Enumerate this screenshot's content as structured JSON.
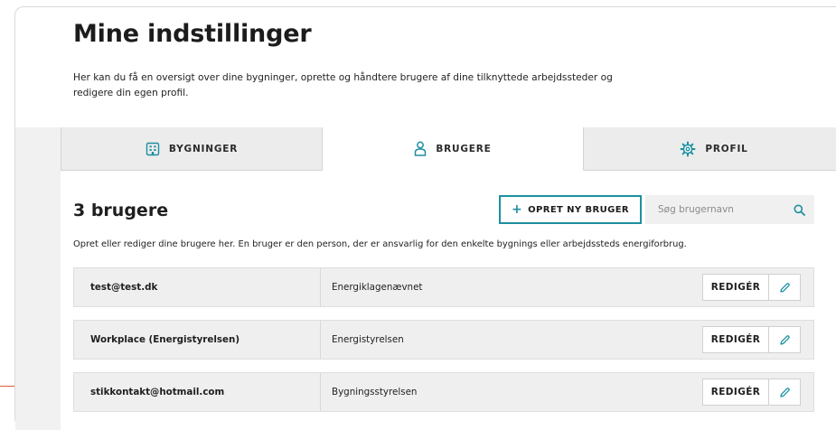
{
  "page": {
    "title": "Mine indstillinger",
    "intro": "Her kan du få en oversigt over dine bygninger, oprette og håndtere brugere af dine tilknyttede arbejdssteder og redigere din egen profil."
  },
  "tabs": [
    {
      "label": "BYGNINGER",
      "icon": "building-icon",
      "active": false
    },
    {
      "label": "BRUGERE",
      "icon": "user-icon",
      "active": true
    },
    {
      "label": "PROFIL",
      "icon": "gear-icon",
      "active": false
    }
  ],
  "users_section": {
    "heading": "3 brugere",
    "create_label": "OPRET NY BRUGER",
    "create_icon": "plus-icon",
    "search_placeholder": "Søg brugernavn",
    "search_icon": "search-icon",
    "help_text": "Opret eller rediger dine brugere her. En bruger er den person, der er ansvarlig for den enkelte bygnings eller arbejdssteds energiforbrug."
  },
  "users": [
    {
      "name": "test@test.dk",
      "organization": "Energiklagenævnet",
      "edit_label": "REDIGÉR"
    },
    {
      "name": "Workplace (Energistyrelsen)",
      "organization": "Energistyrelsen",
      "edit_label": "REDIGÉR"
    },
    {
      "name": "stikkontakt@hotmail.com",
      "organization": "Bygningsstyrelsen",
      "edit_label": "REDIGÉR"
    }
  ],
  "colors": {
    "accent": "#1d8fa0",
    "panel_background": "#f1f1f1",
    "row_background": "#efefef"
  }
}
